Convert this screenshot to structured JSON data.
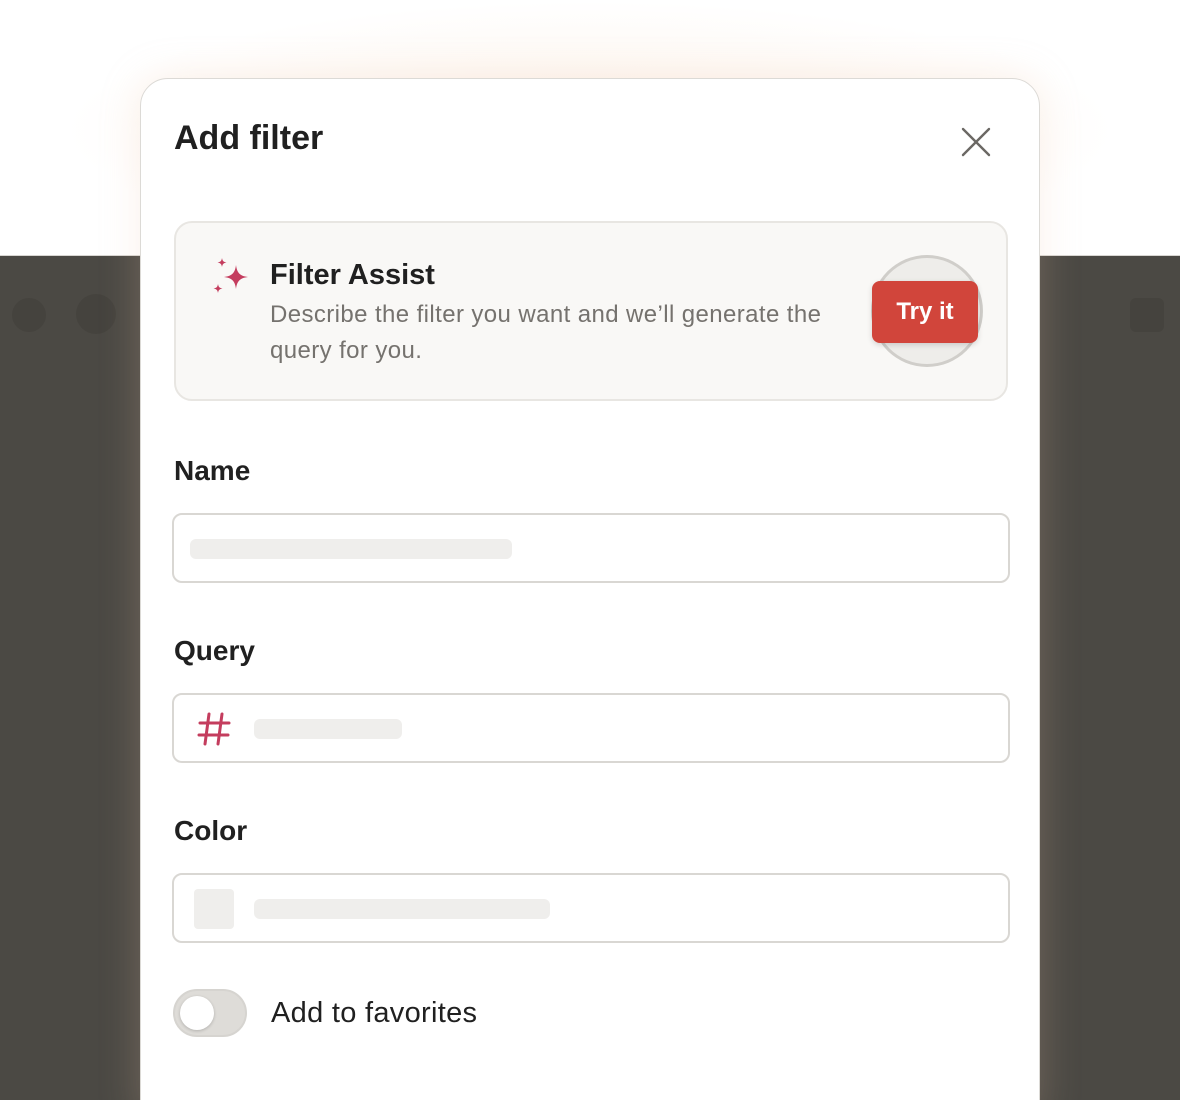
{
  "dialog": {
    "title": "Add filter",
    "close_icon": "close-icon"
  },
  "filter_assist": {
    "icon": "sparkle-icon",
    "title": "Filter Assist",
    "description": "Describe the filter you want and we’ll generate the query for you.",
    "button_label": "Try it",
    "button_color": "#d1453b",
    "icon_color": "#c43d5e"
  },
  "fields": {
    "name": {
      "label": "Name",
      "value": ""
    },
    "query": {
      "label": "Query",
      "icon": "hash-icon",
      "value": ""
    },
    "color": {
      "label": "Color",
      "value": ""
    }
  },
  "favorites": {
    "label": "Add to favorites",
    "enabled": false
  },
  "colors": {
    "accent": "#d1453b",
    "text": "#202020",
    "muted_text": "#75726e",
    "backdrop": "#4b4944"
  }
}
